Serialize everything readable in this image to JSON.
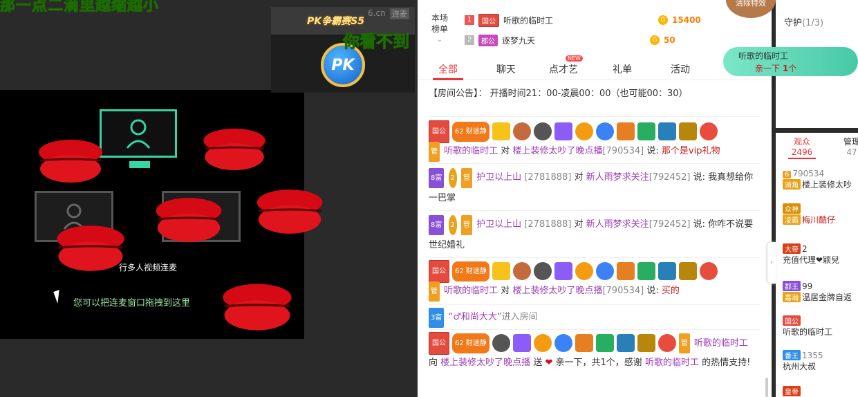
{
  "overlay": {
    "marquee_text": "那一点二滴里越缩越小",
    "pk_hidden_text": "你看不到",
    "pk_label": "PK争霸赛S5",
    "pk_cn": "6.cn",
    "pk_lianmai": "连麦",
    "pk_badge": "PK"
  },
  "stage": {
    "multi_video_tip": "行多人视频连麦",
    "drag_tip": "您可以把连麦窗口拖拽到这里"
  },
  "rank": {
    "title_line1": "本场",
    "title_line2": "榜单",
    "rows": [
      {
        "num": "1",
        "num_color": "#f05555",
        "badge": "国公",
        "name": "听歌的临时工",
        "coins": "15400"
      },
      {
        "num": "2",
        "num_color": "#b9b9b9",
        "badge": "郡公",
        "name": "逐梦九天",
        "coins": "50"
      }
    ]
  },
  "tabs": [
    {
      "label": "全部"
    },
    {
      "label": "聊天"
    },
    {
      "label": "点才艺"
    },
    {
      "label": "礼单"
    },
    {
      "label": "活动"
    }
  ],
  "new_tag": "NEW",
  "notice": "【房间公告】： 开播时间21：00-凌晨00：00（也可能00：30）",
  "messages": [
    {
      "badge": "国公",
      "fortune": "62",
      "fortune_label": "财迷静",
      "from": "听歌的临时工",
      "verb": "对",
      "to": "楼上装修太吵了晚点播",
      "to_id": "[790534]",
      "say": "说:",
      "text": "那个是vip礼物"
    },
    {
      "badge": "8富",
      "rank": "2",
      "from": "护卫以上山",
      "from_id": "[2781888]",
      "verb": "对",
      "to": "新人雨梦求关注",
      "to_id": "[792452]",
      "say": "说:",
      "text": "我真想给你一巴掌"
    },
    {
      "badge": "8富",
      "rank": "2",
      "from": "护卫以上山",
      "from_id": "[2781888]",
      "verb": "对",
      "to": "新人雨梦求关注",
      "to_id": "[792452]",
      "say": "说:",
      "text": "你咋不说要世纪婚礼"
    },
    {
      "badge": "国公",
      "fortune": "62",
      "fortune_label": "财迷静",
      "from": "听歌的临时工",
      "verb": "对",
      "to": "楼上装修太吵了晚点播",
      "to_id": "[790534]",
      "say": "说:",
      "text": "买的"
    },
    {
      "badge": "3富",
      "name": "“♂和尚大大”",
      "text": "进入房间"
    },
    {
      "badge": "国公",
      "fortune": "62",
      "fortune_label": "财迷静",
      "from": "听歌的临时工",
      "verb": "向",
      "to": "楼上装修太吵了晚点播",
      "send": "送",
      "gift_text": "亲一下，共1个，感谢",
      "thanks_name": "听歌的临时工",
      "thanks_suffix": "的热情支持!"
    }
  ],
  "guard": {
    "title": "守护",
    "count": "(1/3)"
  },
  "kiss_banner": {
    "name": "听歌的临时工",
    "line2_prefix": "亲一下",
    "line2_count": "1",
    "line2_suffix": "个"
  },
  "clear_button": "清除特效",
  "audience": {
    "tab_viewers": "观众",
    "tab_viewers_count": "2496",
    "tab_admin": "管理",
    "tab_admin_count": "47",
    "rows": [
      {
        "lvl": "6",
        "text": "790534",
        "sub_badge": "骑角",
        "sub": "楼上装修太吵"
      },
      {
        "lvl": "众神",
        "text": "",
        "sub_badge": "凌霸",
        "sub": "梅川酷仔"
      },
      {
        "lvl": "大帝",
        "text": "2",
        "sub": "充值代理❤颖兒"
      },
      {
        "lvl": "郡王",
        "text": "99",
        "sub_badge": "嘉瀚",
        "sub": "温居金牌自返"
      },
      {
        "lvl": "国公",
        "text": "",
        "sub": "听歌的临时工"
      },
      {
        "lvl": "番王",
        "text": "1355",
        "sub": "杭州大叔"
      },
      {
        "lvl": "皇帝",
        "text": "",
        "sub": ""
      }
    ]
  },
  "colors": {
    "accent_red": "#e33333",
    "name_purple": "#9b3cb5",
    "gold": "#ff7e00",
    "pk_yellow": "#ffe600"
  }
}
